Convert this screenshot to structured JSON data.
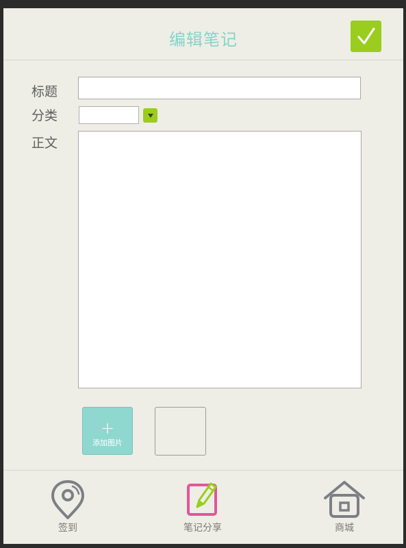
{
  "header": {
    "title": "编辑笔记",
    "confirm_icon": "checkmark-icon"
  },
  "form": {
    "title_label": "标题",
    "title_value": "",
    "category_label": "分类",
    "category_value": "",
    "dropdown_icon": "triangle-down-icon",
    "body_label": "正文",
    "body_value": ""
  },
  "images": {
    "add_plus": "+",
    "add_label": "添加图片"
  },
  "bottom_nav": [
    {
      "label": "签到",
      "icon": "location-pin-icon"
    },
    {
      "label": "笔记分享",
      "icon": "edit-note-icon"
    },
    {
      "label": "商城",
      "icon": "home-icon"
    }
  ],
  "colors": {
    "accent_green": "#9acd1d",
    "accent_teal": "#86d3cb",
    "active_pink": "#e0579a",
    "background": "#eeeee6"
  }
}
